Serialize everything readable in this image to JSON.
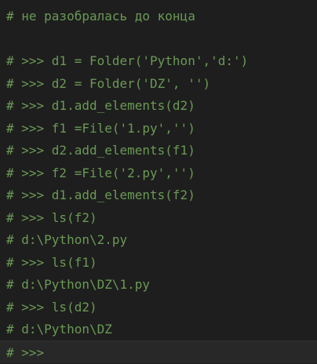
{
  "editor": {
    "colors": {
      "background": "#1e1e1e",
      "comment": "#6a9955",
      "current_line": "#282828"
    },
    "lines": [
      "# не разобралась до конца",
      "",
      "# >>> d1 = Folder('Python','d:')",
      "# >>> d2 = Folder('DZ', '')",
      "# >>> d1.add_elements(d2)",
      "# >>> f1 =File('1.py','')",
      "# >>> d2.add_elements(f1)",
      "# >>> f2 =File('2.py','')",
      "# >>> d1.add_elements(f2)",
      "# >>> ls(f2)",
      "# d:\\Python\\2.py",
      "# >>> ls(f1)",
      "# d:\\Python\\DZ\\1.py",
      "# >>> ls(d2)",
      "# d:\\Python\\DZ",
      "# >>>"
    ]
  }
}
